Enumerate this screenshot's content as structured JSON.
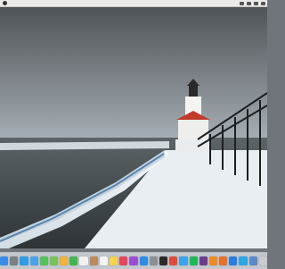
{
  "menubar": {
    "status_text": ""
  },
  "dock": {
    "apps": [
      {
        "icon": "finder-icon",
        "color": "#3c8be6"
      },
      {
        "icon": "launchpad-icon",
        "color": "#7a7f86"
      },
      {
        "icon": "safari-icon",
        "color": "#2f9be6"
      },
      {
        "icon": "mail-icon",
        "color": "#4aa3e8"
      },
      {
        "icon": "messages-icon",
        "color": "#56c15a"
      },
      {
        "icon": "maps-icon",
        "color": "#78c25b"
      },
      {
        "icon": "photos-icon",
        "color": "#f0b23a"
      },
      {
        "icon": "facetime-icon",
        "color": "#45b54f"
      },
      {
        "icon": "calendar-icon",
        "color": "#f2f2f2"
      },
      {
        "icon": "contacts-icon",
        "color": "#b98b5e"
      },
      {
        "icon": "reminders-icon",
        "color": "#f4f4f4"
      },
      {
        "icon": "notes-icon",
        "color": "#f6d34b"
      },
      {
        "icon": "music-icon",
        "color": "#e8465b"
      },
      {
        "icon": "podcasts-icon",
        "color": "#9a4fd2"
      },
      {
        "icon": "appstore-icon",
        "color": "#2b8de6"
      },
      {
        "icon": "settings-icon",
        "color": "#8c9096"
      },
      {
        "icon": "terminal-icon",
        "color": "#2a2a2a"
      },
      {
        "icon": "chrome-icon",
        "color": "#e24b3b"
      },
      {
        "icon": "twitter-icon",
        "color": "#3ba3e9"
      },
      {
        "icon": "spotify-icon",
        "color": "#1db954"
      },
      {
        "icon": "slack-icon",
        "color": "#6b3d8d"
      },
      {
        "icon": "vlc-icon",
        "color": "#f08a24"
      },
      {
        "icon": "firefox-icon",
        "color": "#e8702a"
      },
      {
        "icon": "dropbox-icon",
        "color": "#2a7de1"
      },
      {
        "icon": "skype-icon",
        "color": "#2aa6e0"
      },
      {
        "icon": "downloads-icon",
        "color": "#5c88c9"
      },
      {
        "icon": "trash-icon",
        "color": "#c8ccd1"
      }
    ]
  },
  "colors": {
    "sky_top": "#5a5f63",
    "sky_mid": "#8b9095",
    "horizon": "#a8b2b8",
    "lake": "#3b4245",
    "ice": "#eef3f6",
    "lighthouse_roof": "#c23a2c",
    "dock_bg": "#d4d9df"
  }
}
